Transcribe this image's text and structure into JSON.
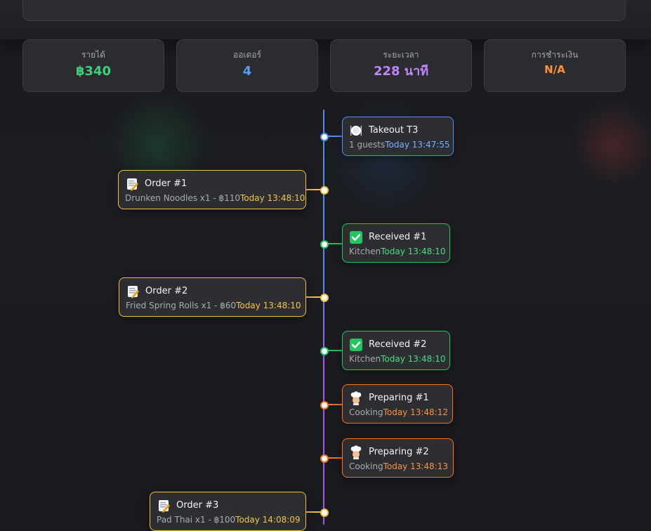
{
  "colors": {
    "blue": "#4f8ef7",
    "yellow": "#f0be37",
    "green": "#22c55e",
    "orange": "#f97316",
    "purple": "#a855f7",
    "teal": "#2dd4bf",
    "stat_income": "#3dd17a",
    "stat_orders": "#5b9cf8",
    "stat_duration": "#c084fc",
    "stat_payment": "#fb923c"
  },
  "stats": {
    "income": {
      "label": "รายได้",
      "value": "฿340"
    },
    "orders": {
      "label": "ออเดอร์",
      "value": "4"
    },
    "duration": {
      "label": "ระยะเวลา",
      "value": "228 นาที"
    },
    "payment": {
      "label": "การชำระเงิน",
      "value": "N/A"
    }
  },
  "timeline": {
    "events": [
      {
        "icon": "plate-utensils-icon",
        "title": "Takeout T3",
        "sub": "1 guests",
        "time": "Today 13:47:55",
        "color": "blue"
      },
      {
        "icon": "memo-pencil-icon",
        "title": "Order #1",
        "sub": "Drunken Noodles x1 - ฿110",
        "time": "Today 13:48:10",
        "color": "yellow"
      },
      {
        "icon": "check-mark-icon",
        "title": "Received #1",
        "sub": "Kitchen",
        "time": "Today 13:48:10",
        "color": "green"
      },
      {
        "icon": "memo-pencil-icon",
        "title": "Order #2",
        "sub": "Fried Spring Rolls x1 - ฿60",
        "time": "Today 13:48:10",
        "color": "yellow"
      },
      {
        "icon": "check-mark-icon",
        "title": "Received #2",
        "sub": "Kitchen",
        "time": "Today 13:48:10",
        "color": "green"
      },
      {
        "icon": "chef-icon",
        "title": "Preparing #1",
        "sub": "Cooking",
        "time": "Today 13:48:12",
        "color": "orange"
      },
      {
        "icon": "chef-icon",
        "title": "Preparing #2",
        "sub": "Cooking",
        "time": "Today 13:48:13",
        "color": "orange"
      },
      {
        "icon": "memo-pencil-icon",
        "title": "Order #3",
        "sub": "Pad Thai x1 - ฿100",
        "time": "Today 14:08:09",
        "color": "yellow"
      }
    ]
  }
}
